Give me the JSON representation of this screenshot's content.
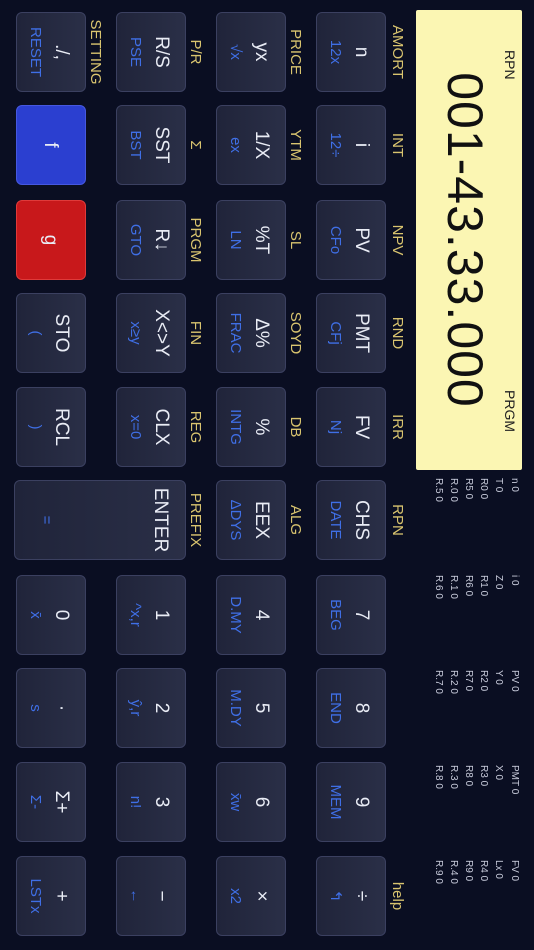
{
  "display": {
    "left_mode": "RPN",
    "right_mode": "PRGM",
    "value": "001-43.33.000"
  },
  "registers": [
    [
      "n",
      "0"
    ],
    [
      "i",
      "0"
    ],
    [
      "PV",
      "0"
    ],
    [
      "PMT",
      "0"
    ],
    [
      "FV",
      "0"
    ],
    [
      "T",
      "0"
    ],
    [
      "Z",
      "0"
    ],
    [
      "Y",
      "0"
    ],
    [
      "X",
      "0"
    ],
    [
      "Lx",
      "0"
    ],
    [
      "R0",
      "0"
    ],
    [
      "R1",
      "0"
    ],
    [
      "R2",
      "0"
    ],
    [
      "R3",
      "0"
    ],
    [
      "R4",
      "0"
    ],
    [
      "R5",
      "0"
    ],
    [
      "R6",
      "0"
    ],
    [
      "R7",
      "0"
    ],
    [
      "R8",
      "0"
    ],
    [
      "R9",
      "0"
    ],
    [
      "R.0",
      "0"
    ],
    [
      "R.1",
      "0"
    ],
    [
      "R.2",
      "0"
    ],
    [
      "R.3",
      "0"
    ],
    [
      "R.4",
      "0"
    ],
    [
      "R.5",
      "0"
    ],
    [
      "R.6",
      "0"
    ],
    [
      "R.7",
      "0"
    ],
    [
      "R.8",
      "0"
    ],
    [
      "R.9",
      "0"
    ]
  ],
  "gold_labels": {
    "r1": [
      "AMORT",
      "INT",
      "NPV",
      "RND",
      "IRR",
      "RPN",
      "help"
    ],
    "r2": [
      "PRICE",
      "YTM",
      "SL",
      "SOYD",
      "DB",
      "ALG"
    ],
    "r3": [
      "P/R",
      "Σ",
      "PRGM",
      "FIN",
      "REG",
      "PREFIX"
    ],
    "r4": [
      "SETTING"
    ]
  },
  "keys": {
    "row1": [
      {
        "main": "n",
        "sub": "12x"
      },
      {
        "main": "i",
        "sub": "12÷"
      },
      {
        "main": "PV",
        "sub": "CFo"
      },
      {
        "main": "PMT",
        "sub": "CFj"
      },
      {
        "main": "FV",
        "sub": "Nj"
      },
      {
        "main": "CHS",
        "sub": "DATE"
      },
      {
        "main": "7",
        "sub": "BEG"
      },
      {
        "main": "8",
        "sub": "END"
      },
      {
        "main": "9",
        "sub": "MEM"
      },
      {
        "main": "÷",
        "sub": "↰"
      }
    ],
    "row2": [
      {
        "main": "yx",
        "sub": "√x"
      },
      {
        "main": "1/X",
        "sub": "ex"
      },
      {
        "main": "%T",
        "sub": "LN"
      },
      {
        "main": "Δ%",
        "sub": "FRAC"
      },
      {
        "main": "%",
        "sub": "INTG"
      },
      {
        "main": "EEX",
        "sub": "ΔDYS"
      },
      {
        "main": "4",
        "sub": "D.MY"
      },
      {
        "main": "5",
        "sub": "M.DY"
      },
      {
        "main": "6",
        "sub": "x̄w"
      },
      {
        "main": "×",
        "sub": "x2"
      }
    ],
    "row3": [
      {
        "main": "R/S",
        "sub": "PSE"
      },
      {
        "main": "SST",
        "sub": "BST"
      },
      {
        "main": "R↓",
        "sub": "GTO"
      },
      {
        "main": "X<>Y",
        "sub": "x≥y"
      },
      {
        "main": "CLX",
        "sub": "x=0"
      },
      {
        "main": "ENTER",
        "sub": "="
      },
      {
        "main": "1",
        "sub": "^x,r"
      },
      {
        "main": "2",
        "sub": "ŷ,r"
      },
      {
        "main": "3",
        "sub": "n!"
      },
      {
        "main": "−",
        "sub": "←"
      }
    ],
    "row4": [
      {
        "main": "./,",
        "sub": "RESET"
      },
      {
        "main": "f",
        "sub": ""
      },
      {
        "main": "g",
        "sub": ""
      },
      {
        "main": "STO",
        "sub": "("
      },
      {
        "main": "RCL",
        "sub": ")"
      },
      {
        "main": "0",
        "sub": "x̄"
      },
      {
        "main": "·",
        "sub": "s"
      },
      {
        "main": "Σ+",
        "sub": "Σ-"
      },
      {
        "main": "+",
        "sub": "LSTx"
      }
    ]
  },
  "colors": {
    "f_key": "#2b3fd0",
    "g_key": "#c8181b",
    "gold": "#d9c46f",
    "blue_text": "#3f6fe6"
  }
}
